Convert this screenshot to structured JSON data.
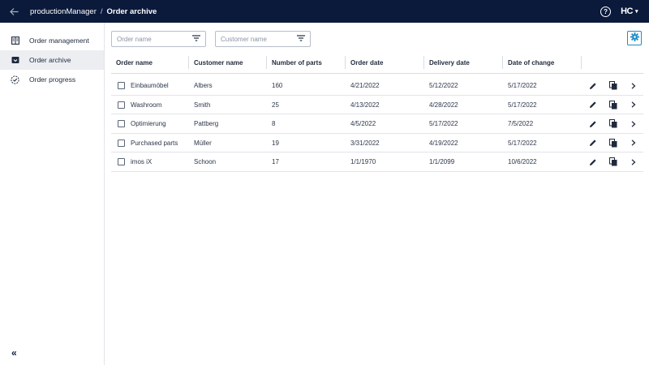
{
  "header": {
    "app_name": "productionManager",
    "separator": "/",
    "current_page": "Order archive",
    "help_glyph": "?",
    "logo_text": "HC",
    "logo_caret": "▾",
    "back_icon": "arrow-left-icon"
  },
  "sidebar": {
    "items": [
      {
        "label": "Order management",
        "icon": "book-icon",
        "active": false
      },
      {
        "label": "Order archive",
        "icon": "archive-box-icon",
        "active": true
      },
      {
        "label": "Order progress",
        "icon": "progress-clock-icon",
        "active": false
      }
    ],
    "collapse_glyph": "«"
  },
  "filters": {
    "order_name_placeholder": "Order name",
    "customer_name_placeholder": "Customer name"
  },
  "table": {
    "columns": [
      "Order name",
      "Customer name",
      "Number of parts",
      "Order date",
      "Delivery date",
      "Date of change"
    ],
    "rows": [
      {
        "name": "Einbaumöbel",
        "customer": "Albers",
        "parts": "160",
        "order_date": "4/21/2022",
        "delivery_date": "5/12/2022",
        "changed": "5/17/2022"
      },
      {
        "name": "Washroom",
        "customer": "Smith",
        "parts": "25",
        "order_date": "4/13/2022",
        "delivery_date": "4/28/2022",
        "changed": "5/17/2022"
      },
      {
        "name": "Optimierung",
        "customer": "Pattberg",
        "parts": "8",
        "order_date": "4/5/2022",
        "delivery_date": "5/17/2022",
        "changed": "7/5/2022"
      },
      {
        "name": "Purchased parts",
        "customer": "Müller",
        "parts": "19",
        "order_date": "3/31/2022",
        "delivery_date": "4/19/2022",
        "changed": "5/17/2022"
      },
      {
        "name": "imos iX",
        "customer": "Schoon",
        "parts": "17",
        "order_date": "1/1/1970",
        "delivery_date": "1/1/2099",
        "changed": "10/6/2022"
      }
    ]
  },
  "colors": {
    "topbar": "#0b1a3b",
    "accent": "#1e8dc6",
    "active_bg": "#eceef2"
  }
}
